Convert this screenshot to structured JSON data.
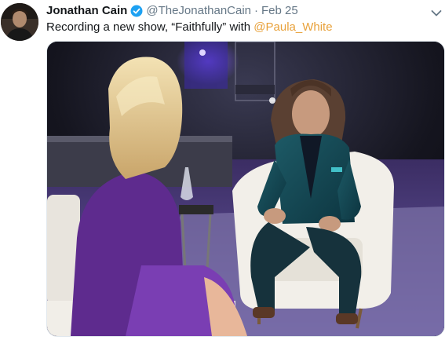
{
  "tweet": {
    "author_name": "Jonathan Cain",
    "author_handle": "@TheJonathanCain",
    "separator": "·",
    "date": "Feb 25",
    "text_prefix": "Recording a new show, “Faithfully” with ",
    "mention": "@Paula_White",
    "verified": true,
    "mention_color": "#e8a13a"
  },
  "icons": {
    "avatar": "avatar-photo",
    "verified": "verified-badge-icon",
    "menu": "chevron-down-icon"
  },
  "media": {
    "description_kind": "photo"
  }
}
